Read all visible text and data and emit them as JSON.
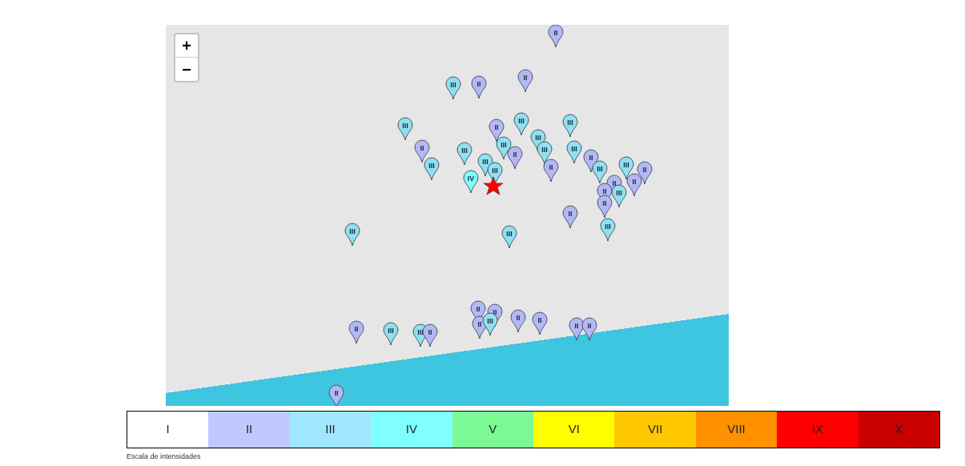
{
  "map": {
    "zoom_controls": [
      "+",
      "−"
    ],
    "pins": [
      {
        "label": "II",
        "color": "#b3b8f5"
      },
      {
        "label": "III",
        "color": "#8fe0f0"
      },
      {
        "label": "II",
        "color": "#b3b8f5"
      },
      {
        "label": "II",
        "color": "#b3b8f5"
      },
      {
        "label": "III",
        "color": "#8fe0f0"
      },
      {
        "label": "II",
        "color": "#b3b8f5"
      },
      {
        "label": "III",
        "color": "#8fe0f0"
      },
      {
        "label": "III",
        "color": "#8fe0f0"
      },
      {
        "label": "II",
        "color": "#b3b8f5"
      },
      {
        "label": "III",
        "color": "#8fe0f0"
      },
      {
        "label": "III",
        "color": "#8fe0f0"
      },
      {
        "label": "III",
        "color": "#8fe0f0"
      },
      {
        "label": "II",
        "color": "#b3b8f5"
      },
      {
        "label": "III",
        "color": "#8fe0f0"
      },
      {
        "label": "III",
        "color": "#8fe0f0"
      },
      {
        "label": "III",
        "color": "#8fe0f0"
      },
      {
        "label": "III",
        "color": "#8fe0f0"
      },
      {
        "label": "II",
        "color": "#b3b8f5"
      },
      {
        "label": "II",
        "color": "#b3b8f5"
      },
      {
        "label": "III",
        "color": "#8fe0f0"
      },
      {
        "label": "II",
        "color": "#b3b8f5"
      },
      {
        "label": "III",
        "color": "#8fe0f0"
      },
      {
        "label": "II",
        "color": "#b3b8f5"
      },
      {
        "label": "III",
        "color": "#8fe0f0"
      },
      {
        "label": "II",
        "color": "#b3b8f5"
      },
      {
        "label": "III",
        "color": "#8fe0f0"
      },
      {
        "label": "III",
        "color": "#8fe0f0"
      },
      {
        "label": "IV",
        "color": "#80ffff"
      },
      {
        "label": "III",
        "color": "#8fe0f0"
      },
      {
        "label": "II",
        "color": "#b3b8f5"
      },
      {
        "label": "III",
        "color": "#8fe0f0"
      },
      {
        "label": "II",
        "color": "#b3b8f5"
      },
      {
        "label": "II",
        "color": "#b3b8f5"
      },
      {
        "label": "III",
        "color": "#8fe0f0"
      },
      {
        "label": "III",
        "color": "#8fe0f0"
      },
      {
        "label": "II",
        "color": "#b3b8f5"
      },
      {
        "label": "II",
        "color": "#b3b8f5"
      },
      {
        "label": "II",
        "color": "#b3b8f5"
      },
      {
        "label": "II",
        "color": "#b3b8f5"
      },
      {
        "label": "III",
        "color": "#8fe0f0"
      },
      {
        "label": "II",
        "color": "#b3b8f5"
      },
      {
        "label": "II",
        "color": "#b3b8f5"
      },
      {
        "label": "II",
        "color": "#b3b8f5"
      },
      {
        "label": "II",
        "color": "#b3b8f5"
      },
      {
        "label": "II",
        "color": "#b3b8f5"
      },
      {
        "label": "II",
        "color": "#b3b8f5"
      }
    ]
  },
  "legend": {
    "levels": [
      {
        "label": "I",
        "color": "#ffffff"
      },
      {
        "label": "II",
        "color": "#bfc8ff"
      },
      {
        "label": "III",
        "color": "#a0e6ff"
      },
      {
        "label": "IV",
        "color": "#80ffff"
      },
      {
        "label": "V",
        "color": "#7cf894"
      },
      {
        "label": "VI",
        "color": "#ffff00"
      },
      {
        "label": "VII",
        "color": "#ffc800"
      },
      {
        "label": "VIII",
        "color": "#ff9100"
      },
      {
        "label": "IX",
        "color": "#ff0000"
      },
      {
        "label": "X",
        "color": "#c80000"
      }
    ],
    "caption": "Escala de intensidades"
  }
}
